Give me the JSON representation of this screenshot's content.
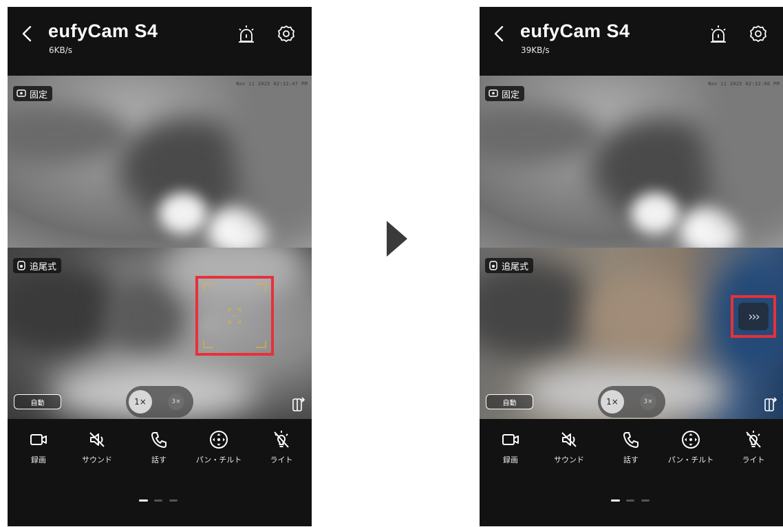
{
  "arrow_icon": "play-triangle-icon",
  "screens": [
    {
      "back_icon": "chevron-left-icon",
      "title": "eufyCam S4",
      "speed": "6KB/s",
      "alarm_icon": "siren-icon",
      "settings_icon": "gear-icon",
      "fixed_feed": {
        "label": "固定",
        "timestamp": "Nov 11 2025  02:32:47 PM"
      },
      "tracking_feed": {
        "label": "追尾式",
        "highlight": "focus-frame"
      },
      "auto_button": "自動",
      "zoom": {
        "zoom_1": "1×",
        "zoom_3": "3×"
      },
      "controls": [
        {
          "label": "録画",
          "icon": "video-camera-icon"
        },
        {
          "label": "サウンド",
          "icon": "speaker-mute-icon"
        },
        {
          "label": "話す",
          "icon": "phone-icon"
        },
        {
          "label": "パン・チルト",
          "icon": "pan-tilt-icon"
        },
        {
          "label": "ライト",
          "icon": "light-off-icon"
        }
      ]
    },
    {
      "back_icon": "chevron-left-icon",
      "title": "eufyCam S4",
      "speed": "39KB/s",
      "alarm_icon": "siren-icon",
      "settings_icon": "gear-icon",
      "fixed_feed": {
        "label": "固定",
        "timestamp": "Nov 11 2025  02:32:06 PM"
      },
      "tracking_feed": {
        "label": "追尾式",
        "highlight": "forward-button",
        "forward_label": "›››"
      },
      "auto_button": "自動",
      "zoom": {
        "zoom_1": "1×",
        "zoom_3": "3×"
      },
      "controls": [
        {
          "label": "録画",
          "icon": "video-camera-icon"
        },
        {
          "label": "サウンド",
          "icon": "speaker-mute-icon"
        },
        {
          "label": "話す",
          "icon": "phone-icon"
        },
        {
          "label": "パン・チルト",
          "icon": "pan-tilt-icon"
        },
        {
          "label": "ライト",
          "icon": "light-off-icon"
        }
      ]
    }
  ],
  "colors": {
    "highlight": "#e8303a",
    "background": "#121212",
    "focus_frame": "#e0b23a"
  }
}
